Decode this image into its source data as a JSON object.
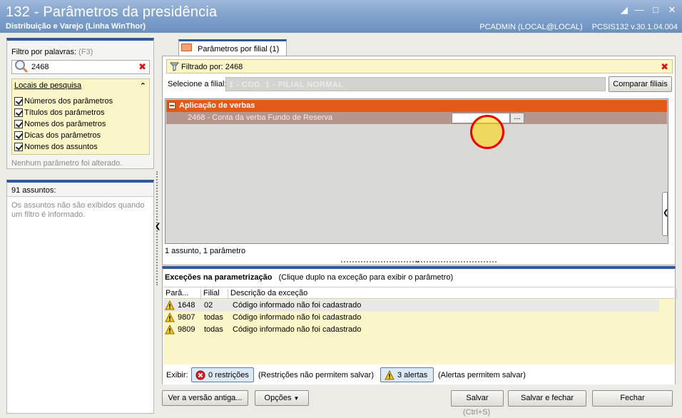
{
  "window": {
    "title": "132 - Parâmetros da presidência",
    "subtitle": "Distribuição e Varejo (Linha WinThor)",
    "user": "PCADMIN (LOCAL@LOCAL)",
    "version": "PCSIS132  v.30.1.04.004"
  },
  "left": {
    "filter_label": "Filtro por palavras:",
    "filter_hint": "(F3)",
    "search_value": "2468",
    "locals_header": "Locais de pesquisa",
    "locals_items": [
      {
        "label": "Números dos parâmetros",
        "checked": true
      },
      {
        "label": "Títulos dos parâmetros",
        "checked": true
      },
      {
        "label": "Nomes dos parâmetros",
        "checked": true
      },
      {
        "label": "Dicas dos parâmetros",
        "checked": true
      },
      {
        "label": "Nomes dos assuntos",
        "checked": true
      }
    ],
    "no_change": "Nenhum parâmetro foi alterado.",
    "subjects_count": "91 assuntos:",
    "subjects_msg": "Os assuntos não são exibidos quando um filtro é informado."
  },
  "tab": {
    "label": "Parâmetros por filial",
    "count": "(1)"
  },
  "filter_bar": {
    "text": "Filtrado por: 2468"
  },
  "branch": {
    "label": "Selecione a filial:",
    "value": "1 - COD. 1 - FILIAL NORMAL",
    "compare_button": "Comparar filiais"
  },
  "params": {
    "group": "Aplicação de verbas",
    "row": "2468 - Conta da verba Fundo de Reserva",
    "row_button": "...",
    "summary": "1 assunto, 1 parâmetro"
  },
  "exceptions": {
    "title": "Exceções na parametrização",
    "hint": "(Clique duplo na exceção para exibir o parâmetro)",
    "columns": [
      "Parâ...",
      "Filial",
      "Descrição da exceção"
    ],
    "rows": [
      {
        "param": "1648",
        "filial": "02",
        "desc": "Código informado não foi cadastrado"
      },
      {
        "param": "9807",
        "filial": "todas",
        "desc": "Código informado não foi cadastrado"
      },
      {
        "param": "9809",
        "filial": "todas",
        "desc": "Código informado não foi cadastrado"
      }
    ],
    "show_label": "Exibir:",
    "restrictions_button": "0 restrições",
    "restrictions_note": "(Restrições não permitem salvar)",
    "alerts_button": "3 alertas",
    "alerts_note": "(Alertas permitem salvar)"
  },
  "footer": {
    "old_version": "Ver a versão antiga...",
    "options": "Opções",
    "save": "Salvar",
    "save_shortcut": "(Ctrl+S)",
    "save_close": "Salvar e fechar",
    "close": "Fechar"
  },
  "colors": {
    "accent_blue": "#2d5b99",
    "group_orange": "#e25a1a",
    "highlight_yellow": "#fbf6c8"
  }
}
